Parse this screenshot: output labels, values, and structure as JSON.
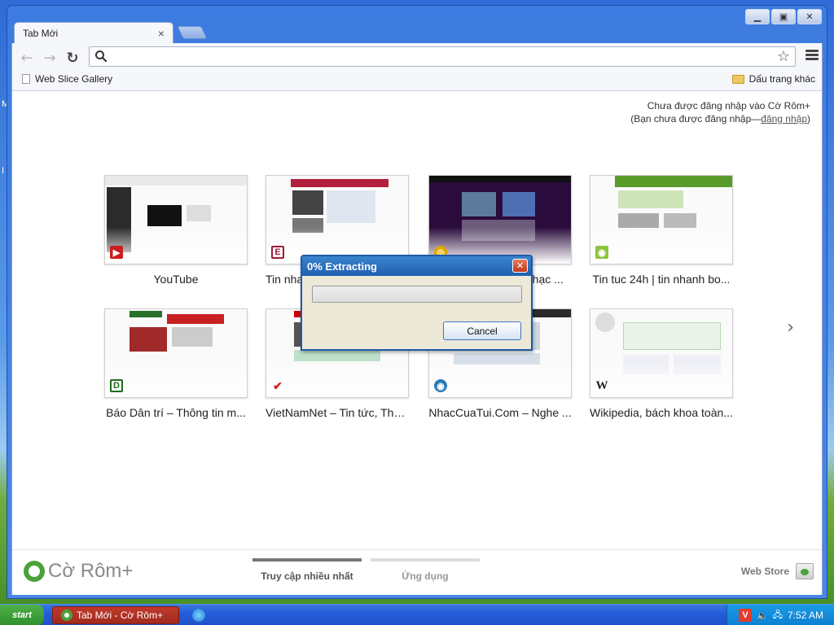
{
  "desktop": {
    "marks": [
      "M",
      "I"
    ]
  },
  "window": {
    "controls": {
      "minimize": "▁",
      "maximize": "▣",
      "close": "✕"
    },
    "tab": {
      "title": "Tab Mới",
      "close": "×"
    },
    "toolbar": {
      "back": "←",
      "forward": "→",
      "reload": "↻",
      "omnibox_value": "",
      "star": "☆"
    },
    "bookmarks": {
      "left_label": "Web Slice Gallery",
      "right_label": "Dấu trang khác"
    }
  },
  "signin": {
    "line1": "Chưa được đăng nhập vào Cờ Rôm+",
    "line2_prefix": "(Bạn chưa được đăng nhập—",
    "line2_link": "đăng nhập",
    "line2_suffix": ")"
  },
  "tiles": [
    {
      "title": "YouTube",
      "fav": "▶",
      "color": "#cc1f1f"
    },
    {
      "title": "Tin nhanh VnExpress - Tin nhanh...",
      "fav": "E",
      "color": "#9b1c3c"
    },
    {
      "title": "Zing MP3 - Nghe nhạc ...",
      "fav": "◎",
      "color": "#e2a800"
    },
    {
      "title": "Tin tuc 24h | tin nhanh bo...",
      "fav": "◉",
      "color": "#8cc63e"
    },
    {
      "title": "Báo Dân trí – Thông tin m...",
      "fav": "D",
      "color": "#1e6b1e"
    },
    {
      "title": "VietNamNet – Tin tức, Thời...",
      "fav": "✔",
      "color": "#d42020"
    },
    {
      "title": "NhacCuaTui.Com – Nghe ...",
      "fav": "◉",
      "color": "#2a7bb5"
    },
    {
      "title": "Wikipedia, bách khoa toàn...",
      "fav": "W",
      "color": "#222222"
    }
  ],
  "next_arrow": "›",
  "footer": {
    "logo_text": "Cờ Rôm+",
    "tab_most_visited": "Truy cập nhiều nhất",
    "tab_apps": "Ứng dụng",
    "webstore": "Web Store"
  },
  "dialog": {
    "title": "0% Extracting",
    "close": "✕",
    "progress": 0,
    "cancel": "Cancel"
  },
  "taskbar": {
    "start": "start",
    "task_label": "Tab Mới - Cờ Rôm+",
    "tray_v": "V",
    "clock": "7:52 AM"
  },
  "colors": {
    "accent": "#3d7be0",
    "dialog_title": "#1f5fb0",
    "active_tab_bar": "#777777",
    "inactive_tab_bar": "#dddddd"
  }
}
